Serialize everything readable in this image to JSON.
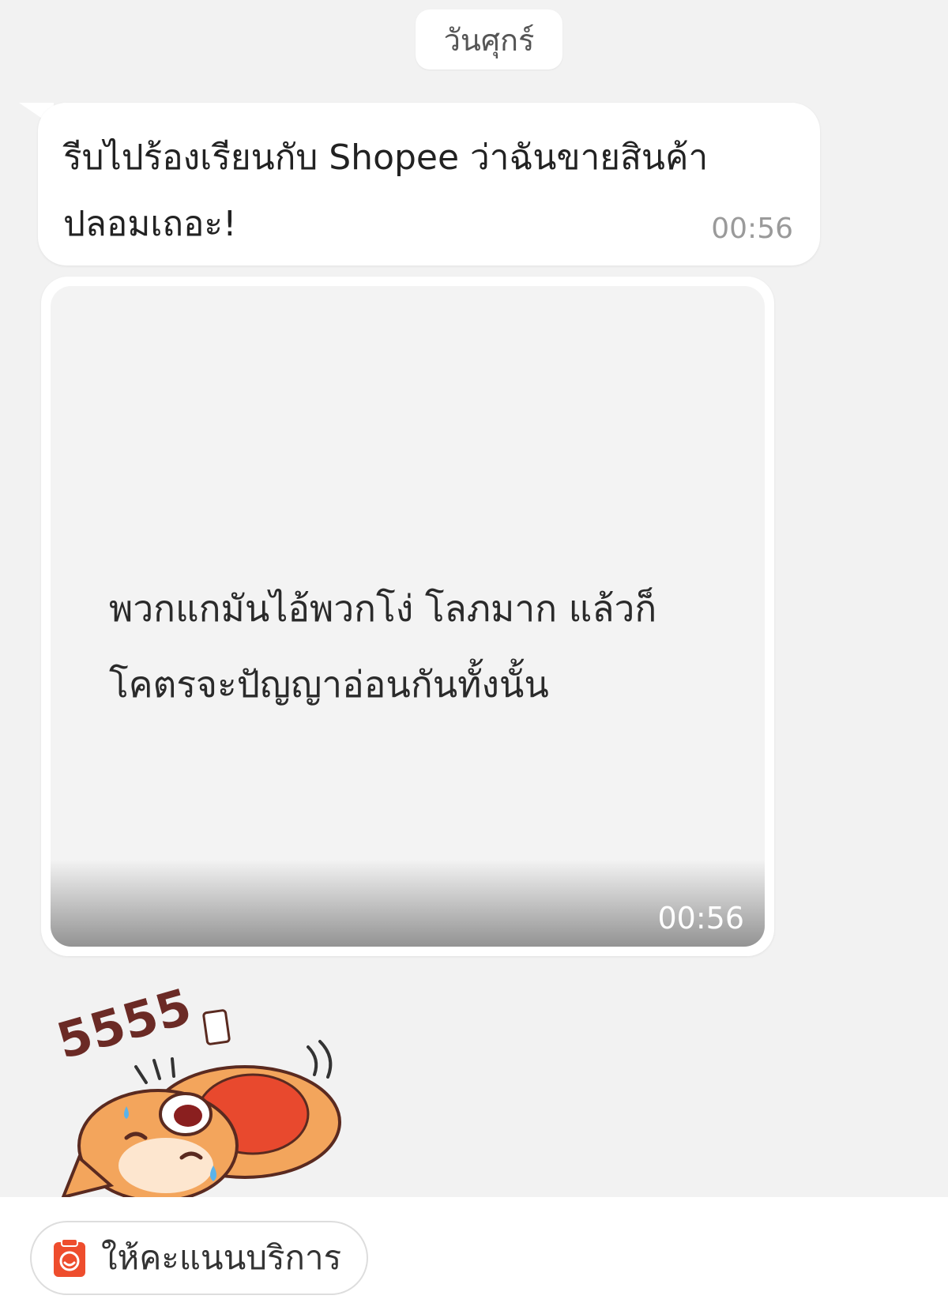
{
  "chat": {
    "date_label": "วันศุกร์",
    "messages": [
      {
        "text_line1": "รีบไปร้องเรียนกับ Shopee ว่าฉันขายสินค้า",
        "text_line2": "ปลอมเถอะ!",
        "time": "00:56"
      }
    ],
    "image_message": {
      "text_line1": "พวกแกมันไอ้พวกโง่ โลภมาก แล้วก็",
      "text_line2": "โคตรจะปัญญาอ่อนกันทั้งนั้น",
      "time": "00:56"
    },
    "sticker": {
      "text": "5555",
      "icon": "laughing-fox-sticker"
    }
  },
  "bottom": {
    "rate_service_label": "ให้คะแนนบริการ",
    "rate_service_icon": "rate-service-icon"
  },
  "colors": {
    "accent": "#ee4d2d",
    "background": "#f2f2f2"
  }
}
